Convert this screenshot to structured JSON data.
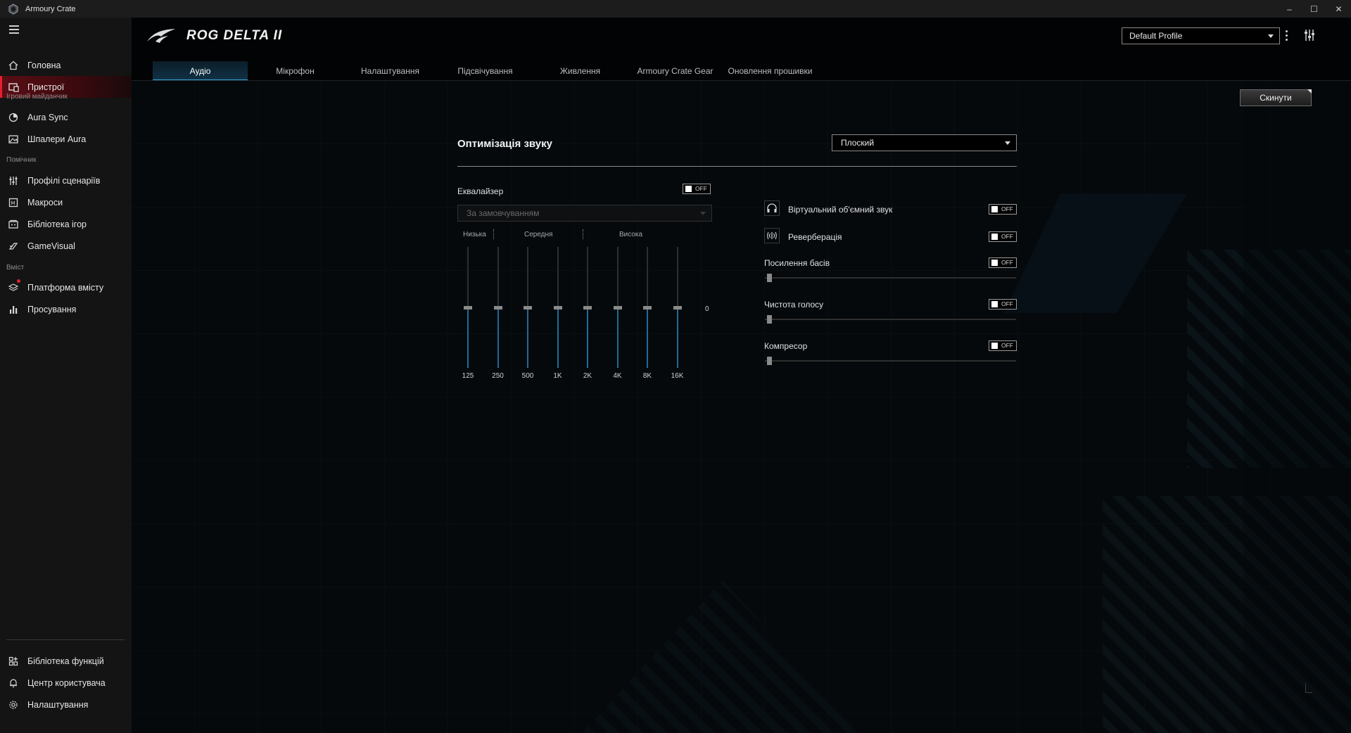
{
  "window": {
    "title": "Armoury Crate",
    "controls": {
      "minimize": "–",
      "maximize": "☐",
      "close": "✕"
    }
  },
  "sidebar": {
    "items_top": [
      {
        "label": "Головна",
        "icon": "home-icon"
      },
      {
        "label": "Пристрої",
        "icon": "devices-icon",
        "active": true
      }
    ],
    "section_gaming": "Ігровий майданчик",
    "items_gaming": [
      {
        "label": "Aura Sync",
        "icon": "aura-sync-icon"
      },
      {
        "label": "Шпалери Aura",
        "icon": "wallpaper-icon"
      }
    ],
    "section_helper": "Помічник",
    "items_helper": [
      {
        "label": "Профілі сценаріїв",
        "icon": "scenario-profiles-icon"
      },
      {
        "label": "Макроси",
        "icon": "macros-icon"
      },
      {
        "label": "Бібліотека ігор",
        "icon": "game-library-icon"
      },
      {
        "label": "GameVisual",
        "icon": "gamevisual-icon"
      }
    ],
    "section_content": "Вміст",
    "items_content": [
      {
        "label": "Платформа вмісту",
        "icon": "content-platform-icon"
      },
      {
        "label": "Просування",
        "icon": "promotion-icon"
      }
    ],
    "items_bottom": [
      {
        "label": "Бібліотека функцій",
        "icon": "feature-library-icon"
      },
      {
        "label": "Центр користувача",
        "icon": "user-center-icon"
      },
      {
        "label": "Налаштування",
        "icon": "settings-icon"
      }
    ]
  },
  "header": {
    "device_title": "ROG DELTA II",
    "profile": "Default Profile"
  },
  "tabs": [
    {
      "label": "Аудіо",
      "active": true
    },
    {
      "label": "Мікрофон"
    },
    {
      "label": "Налаштування"
    },
    {
      "label": "Підсвічування"
    },
    {
      "label": "Живлення"
    },
    {
      "label": "Armoury Crate Gear"
    },
    {
      "label": "Оновлення прошивки"
    }
  ],
  "reset_button": "Скинути",
  "sound": {
    "title": "Оптимізація звуку",
    "preset": "Плоский"
  },
  "equalizer": {
    "label": "Еквалайзер",
    "toggle": "OFF",
    "preset_placeholder": "За замовчуванням",
    "bands": {
      "low": "Низька",
      "mid": "Середня",
      "high": "Висока"
    },
    "zero_label": "0",
    "frequencies": [
      {
        "label": "125",
        "gain": 0
      },
      {
        "label": "250",
        "gain": 0
      },
      {
        "label": "500",
        "gain": 0
      },
      {
        "label": "1K",
        "gain": 0
      },
      {
        "label": "2K",
        "gain": 0
      },
      {
        "label": "4K",
        "gain": 0
      },
      {
        "label": "8K",
        "gain": 0
      },
      {
        "label": "16K",
        "gain": 0
      }
    ]
  },
  "effects": {
    "virtual_surround": {
      "label": "Віртуальний об'ємний звук",
      "toggle": "OFF",
      "icon": "headphones-icon"
    },
    "reverb": {
      "label": "Реверберація",
      "toggle": "OFF",
      "icon": "reverb-icon"
    },
    "bass_boost": {
      "label": "Посилення басів",
      "toggle": "OFF",
      "level": 0
    },
    "voice_clarity": {
      "label": "Чистота голосу",
      "toggle": "OFF",
      "level": 0
    },
    "compressor": {
      "label": "Компресор",
      "toggle": "OFF",
      "level": 0
    }
  },
  "colors": {
    "accent_red": "#e4202f",
    "accent_blue": "#3fa6d9"
  }
}
